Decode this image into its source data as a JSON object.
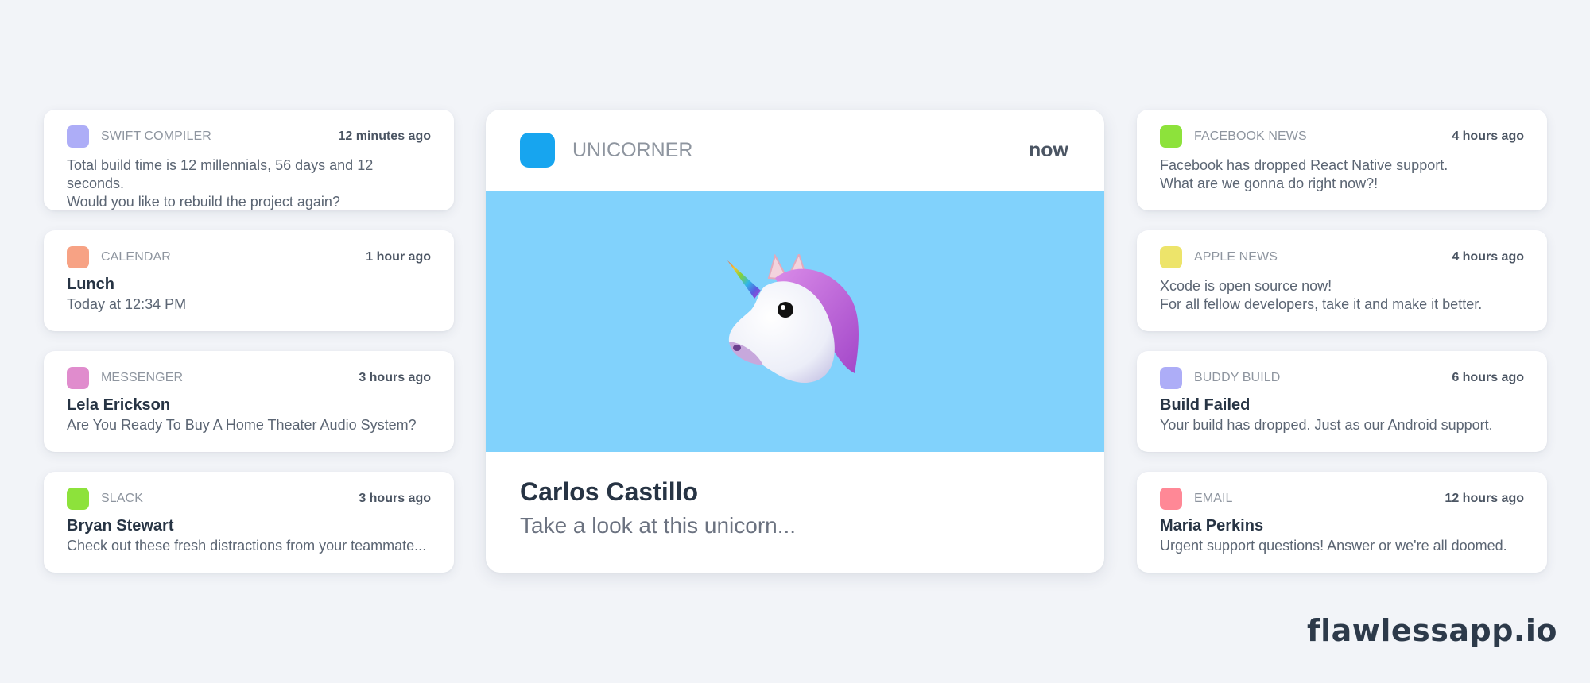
{
  "left_column": [
    {
      "app": "SWIFT COMPILER",
      "icon_color": "#adadf7",
      "time": "12 minutes ago",
      "title": null,
      "body_lines": [
        "Total build time is 12 millennials, 56 days and 12 seconds.",
        "Would you like to rebuild the project again?"
      ]
    },
    {
      "app": "CALENDAR",
      "icon_color": "#f7a284",
      "time": "1 hour ago",
      "title": "Lunch",
      "body_lines": [
        "Today at 12:34 PM"
      ]
    },
    {
      "app": "MESSENGER",
      "icon_color": "#e08ccd",
      "time": "3 hours ago",
      "title": "Lela Erickson",
      "body_lines": [
        "Are You Ready To Buy A Home Theater Audio System?"
      ]
    },
    {
      "app": "SLACK",
      "icon_color": "#8de23b",
      "time": "3 hours ago",
      "title": "Bryan Stewart",
      "body_lines": [
        "Check out these fresh distractions from your teammate..."
      ]
    }
  ],
  "featured": {
    "app": "UNICORNER",
    "icon_color": "#17a5ef",
    "time": "now",
    "image": "unicorn-emoji",
    "image_bg": "#81d2fc",
    "title": "Carlos Castillo",
    "body": "Take a look at this unicorn..."
  },
  "right_column": [
    {
      "app": "FACEBOOK NEWS",
      "icon_color": "#8de23b",
      "time": "4 hours ago",
      "title": null,
      "body_lines": [
        "Facebook has dropped React Native support.",
        "What are we gonna do right now?!"
      ]
    },
    {
      "app": "APPLE NEWS",
      "icon_color": "#ede46a",
      "time": "4 hours ago",
      "title": null,
      "body_lines": [
        "Xcode is open source now!",
        "For all fellow developers, take it and make it better."
      ]
    },
    {
      "app": "BUDDY BUILD",
      "icon_color": "#adadf7",
      "time": "6 hours ago",
      "title": "Build Failed",
      "body_lines": [
        "Your build has dropped. Just as our Android support."
      ]
    },
    {
      "app": "EMAIL",
      "icon_color": "#ff8896",
      "time": "12 hours ago",
      "title": "Maria Perkins",
      "body_lines": [
        "Urgent support questions! Answer or we're all doomed."
      ]
    }
  ],
  "brand": "flawlessapp.io"
}
